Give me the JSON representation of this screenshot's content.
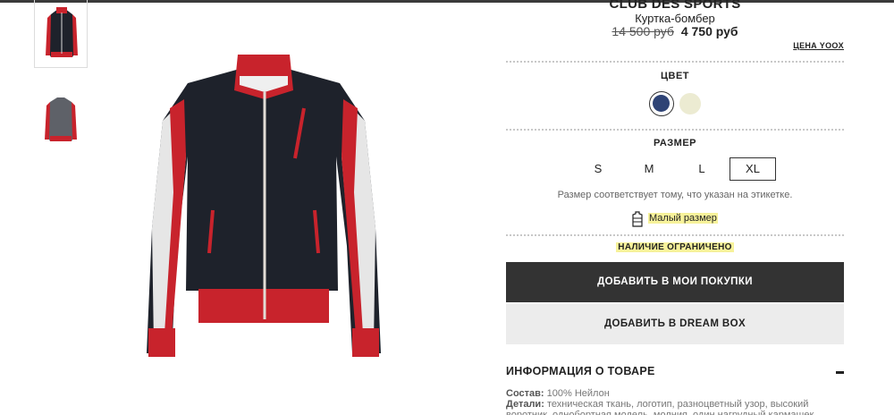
{
  "product": {
    "brand": "CLUB DES SPORTS",
    "type": "Куртка-бомбер",
    "old_price": "14 500 руб",
    "new_price": "4 750 руб",
    "price_note": "ЦЕНА YOOX"
  },
  "color_section": {
    "title": "ЦВЕТ",
    "swatches": [
      {
        "name": "navy",
        "color": "#2e4375"
      },
      {
        "name": "cream",
        "color": "#ecebd2"
      }
    ]
  },
  "size_section": {
    "title": "РАЗМЕР",
    "sizes": [
      "S",
      "M",
      "L",
      "XL"
    ],
    "selected": "XL",
    "note": "Размер соответствует тому, что указан на этикетке.",
    "fit_label": "Малый размер"
  },
  "availability": "НАЛИЧИЕ ОГРАНИЧЕНО",
  "buttons": {
    "add_to_bag": "ДОБАВИТЬ В МОИ ПОКУПКИ",
    "add_to_dreambox": "ДОБАВИТЬ В DREAM BOX"
  },
  "info": {
    "title": "ИНФОРМАЦИЯ О ТОВАРЕ",
    "composition_label": "Состав:",
    "composition": "100% Нейлон",
    "details_label": "Детали:",
    "details": "техническая ткань, логотип, разноцветный узор, высокий воротник, однобортная модель, молния, один нагрудный кармашек"
  },
  "colors": {
    "accent_dark": "#333333",
    "highlight": "#f7f29a",
    "jacket_body": "#1e222b",
    "jacket_red": "#c8232c"
  }
}
